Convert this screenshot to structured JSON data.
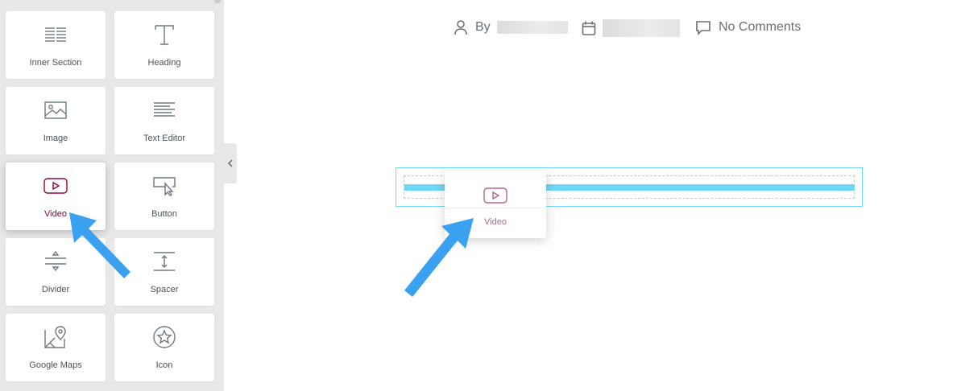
{
  "panel": {
    "widgets": [
      {
        "label": "Inner Section",
        "icon": "inner-section-icon"
      },
      {
        "label": "Heading",
        "icon": "heading-icon"
      },
      {
        "label": "Image",
        "icon": "image-icon"
      },
      {
        "label": "Text Editor",
        "icon": "text-editor-icon"
      },
      {
        "label": "Video",
        "icon": "video-icon"
      },
      {
        "label": "Button",
        "icon": "button-icon"
      },
      {
        "label": "Divider",
        "icon": "divider-icon"
      },
      {
        "label": "Spacer",
        "icon": "spacer-icon"
      },
      {
        "label": "Google Maps",
        "icon": "google-maps-icon"
      },
      {
        "label": "Icon",
        "icon": "star-icon"
      }
    ],
    "active_widget": "Video"
  },
  "post_meta": {
    "by_label": "By",
    "comments_label": "No Comments"
  },
  "drag_ghost": {
    "label": "Video",
    "icon": "video-icon"
  },
  "colors": {
    "panel_bg": "#e6e8ea",
    "accent": "#93003c",
    "drop_indicator": "#71d7f7",
    "arrow": "#3aa0f0"
  }
}
